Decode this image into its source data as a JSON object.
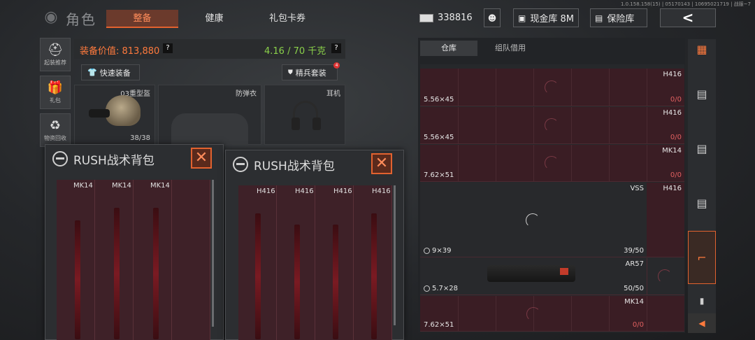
{
  "version": "1.0.158.158(15) | 05170143 | 10695021719 | 战服~7",
  "header": {
    "title": "角色",
    "tabs": [
      {
        "label": "整备",
        "active": true
      },
      {
        "label": "健康",
        "active": false
      },
      {
        "label": "礼包卡券",
        "active": false
      }
    ],
    "cash": "338816",
    "vault_label": "现金库 8M",
    "safe_label": "保险库",
    "back_icon": "chevron-left-icon"
  },
  "sidebar": {
    "items": [
      {
        "label": "起装推荐",
        "icon": "helmet-icon"
      },
      {
        "label": "礼包",
        "icon": "gift-icon"
      },
      {
        "label": "物资回收",
        "icon": "recycle-icon"
      }
    ]
  },
  "equipment": {
    "value_label": "装备价值: 813,880",
    "weight_label": "4.16 / 70 千克",
    "help": "?",
    "quick_equip": "快速装备",
    "elite_set": "精兵套装",
    "elite_badge": "4",
    "slots": [
      {
        "label": "03重型盔",
        "count": "38/38"
      },
      {
        "label": "防弹衣",
        "count": ""
      },
      {
        "label": "耳机",
        "count": ""
      }
    ]
  },
  "packs": [
    {
      "title": "RUSH战术背包",
      "weapons": [
        "MK14",
        "MK14",
        "MK14"
      ]
    },
    {
      "title": "RUSH战术背包",
      "weapons": [
        "H416",
        "H416",
        "H416",
        "H416"
      ]
    }
  ],
  "warehouse": {
    "tabs": [
      {
        "label": "仓库",
        "active": true
      },
      {
        "label": "组队借用",
        "active": false
      }
    ],
    "rows": [
      {
        "name": "H416",
        "caliber": "5.56×45",
        "count": "0/0",
        "style": "red"
      },
      {
        "name": "H416",
        "caliber": "5.56×45",
        "count": "0/0",
        "style": "red"
      },
      {
        "name": "MK14",
        "caliber": "7.62×51",
        "count": "0/0",
        "style": "red"
      },
      {
        "name": "VSS",
        "name2": "H416",
        "caliber": "9×39",
        "count": "39/50",
        "style": "dark"
      },
      {
        "name": "AR57",
        "caliber": "5.7×28",
        "count": "50/50",
        "style": "dark"
      },
      {
        "name": "MK14",
        "caliber": "7.62×51",
        "count": "0/0",
        "style": "red"
      }
    ]
  },
  "rail": {
    "items": [
      "grid-icon",
      "ammo-box-icon",
      "ammo-box-icon",
      "ammo-box-icon",
      "rifle-icon",
      "bullet-icon"
    ],
    "active_index": 4,
    "collapse_icon": "triangle-left-icon"
  },
  "colors": {
    "accent": "#e2622f",
    "value": "#ff7a3d",
    "weight": "#8ad04a",
    "empty_count": "#e06060"
  }
}
